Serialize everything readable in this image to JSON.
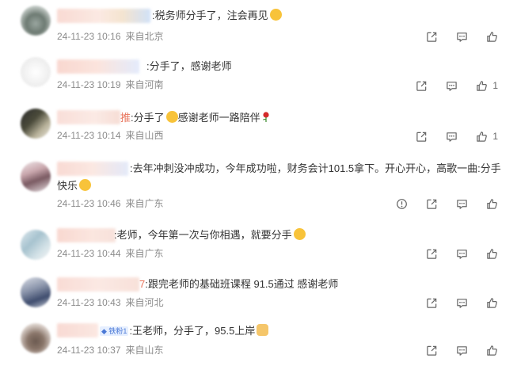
{
  "comments": [
    {
      "text": ":税务师分手了，注会再见",
      "time": "24-11-23 10:16",
      "source": "来自北京",
      "likes": ""
    },
    {
      "text": ":分手了，感谢老师",
      "time": "24-11-23 10:19",
      "source": "来自河南",
      "likes": "1"
    },
    {
      "name_tail": "推",
      "text_a": ":分手了",
      "text_b": "感谢老师一路陪伴",
      "time": "24-11-23 10:14",
      "source": "来自山西",
      "likes": "1"
    },
    {
      "text": ":去年冲刺没冲成功，今年成功啦，财务会计101.5拿下。开心开心，高歌一曲:分手快乐",
      "time": "24-11-23 10:46",
      "source": "来自广东",
      "likes": ""
    },
    {
      "text": ":老师，今年第一次与你相遇，就要分手",
      "time": "24-11-23 10:44",
      "source": "来自广东",
      "likes": ""
    },
    {
      "name_tail": "7",
      "text": ":跟完老师的基础班课程 91.5通过 感谢老师",
      "time": "24-11-23 10:43",
      "source": "来自河北",
      "likes": ""
    },
    {
      "badge": "铁粉1",
      "text": ":王老师，分手了，95.5上岸",
      "time": "24-11-23 10:37",
      "source": "来自山东",
      "likes": ""
    }
  ],
  "icons": {
    "share": "share-icon",
    "comment": "comment-icon",
    "like": "like-icon",
    "report": "report-icon"
  },
  "colors": {
    "meta": "#8b8b8b",
    "name_tail": "#e8735a",
    "badge_bg": "#e6efff",
    "badge_text": "#4a78d6"
  }
}
